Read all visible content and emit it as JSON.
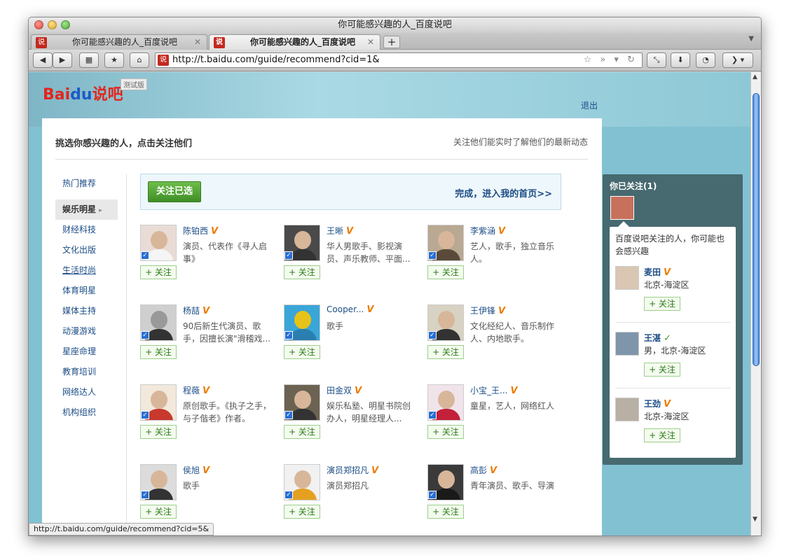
{
  "window": {
    "title": "你可能感兴趣的人_百度说吧"
  },
  "tabs": [
    {
      "label": "你可能感兴趣的人_百度说吧",
      "favicon": "说"
    },
    {
      "label": "你可能感兴趣的人_百度说吧",
      "favicon": "说"
    }
  ],
  "toolbar": {
    "new_tab": "+",
    "url": "http://t.baidu.com/guide/recommend?cid=1&"
  },
  "page": {
    "logo_text": "Bai",
    "logo_paw": "du",
    "logo_suffix": "说吧",
    "beta": "测试版",
    "logout": "退出",
    "heading": "挑选你感兴趣的人，点击关注他们",
    "note": "关注他们能实时了解他们的最新动态",
    "follow_selected": "关注已选",
    "done": "完成，进入我的首页>>",
    "follow_label": "+ 关注",
    "vmark": "V"
  },
  "categories": [
    "热门推荐",
    "娱乐明星",
    "财经科技",
    "文化出版",
    "生活时尚",
    "体育明星",
    "媒体主持",
    "动漫游戏",
    "星座命理",
    "教育培训",
    "网络达人",
    "机构组织"
  ],
  "people": [
    {
      "name": "陈铂西",
      "desc": "演员、代表作《寻人启事》"
    },
    {
      "name": "王晰",
      "desc": "华人男歌手、影视演员、声乐教师、平面..."
    },
    {
      "name": "李紫涵",
      "desc": "艺人，歌手，独立音乐人。"
    },
    {
      "name": "杨喆",
      "desc": "90后新生代演员、歌手，因擅长演\"滑稽戏..."
    },
    {
      "name": "Cooper...",
      "desc": "歌手"
    },
    {
      "name": "王伊锋",
      "desc": "文化经纪人、音乐制作人、内地歌手。"
    },
    {
      "name": "程薇",
      "desc": "原创歌手。《执子之手，与子偕老》作者。"
    },
    {
      "name": "田金双",
      "desc": "娱乐私塾、明星书院创办人，明星经理人..."
    },
    {
      "name": "小宝_王...",
      "desc": "童星，艺人，网络红人"
    },
    {
      "name": "侯旭",
      "desc": "歌手"
    },
    {
      "name": "演员郑招凡",
      "desc": "演员郑招凡"
    },
    {
      "name": "高彭",
      "desc": "青年演员、歌手、导演"
    }
  ],
  "following": {
    "title": "你已关注(1)",
    "intro": "百度说吧关注的人，你可能也会感兴趣",
    "users": [
      {
        "name": "麦田",
        "loc": "北京-海淀区",
        "vmark": "V"
      },
      {
        "name": "王湛",
        "loc": "男，北京-海淀区",
        "vmark": "✓"
      },
      {
        "name": "王劲",
        "loc": "北京-海淀区",
        "vmark": "V"
      }
    ]
  },
  "status_url": "http://t.baidu.com/guide/recommend?cid=5&"
}
